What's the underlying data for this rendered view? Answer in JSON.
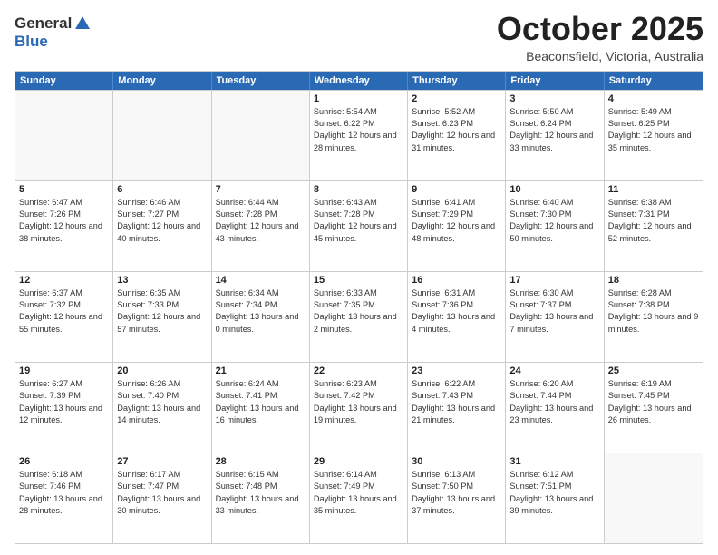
{
  "logo": {
    "line1": "General",
    "line2": "Blue"
  },
  "title": "October 2025",
  "location": "Beaconsfield, Victoria, Australia",
  "days_of_week": [
    "Sunday",
    "Monday",
    "Tuesday",
    "Wednesday",
    "Thursday",
    "Friday",
    "Saturday"
  ],
  "weeks": [
    [
      {
        "day": "",
        "empty": true
      },
      {
        "day": "",
        "empty": true
      },
      {
        "day": "",
        "empty": true
      },
      {
        "day": "1",
        "sunrise": "5:54 AM",
        "sunset": "6:22 PM",
        "daylight": "12 hours and 28 minutes."
      },
      {
        "day": "2",
        "sunrise": "5:52 AM",
        "sunset": "6:23 PM",
        "daylight": "12 hours and 31 minutes."
      },
      {
        "day": "3",
        "sunrise": "5:50 AM",
        "sunset": "6:24 PM",
        "daylight": "12 hours and 33 minutes."
      },
      {
        "day": "4",
        "sunrise": "5:49 AM",
        "sunset": "6:25 PM",
        "daylight": "12 hours and 35 minutes."
      }
    ],
    [
      {
        "day": "5",
        "sunrise": "6:47 AM",
        "sunset": "7:26 PM",
        "daylight": "12 hours and 38 minutes."
      },
      {
        "day": "6",
        "sunrise": "6:46 AM",
        "sunset": "7:27 PM",
        "daylight": "12 hours and 40 minutes."
      },
      {
        "day": "7",
        "sunrise": "6:44 AM",
        "sunset": "7:28 PM",
        "daylight": "12 hours and 43 minutes."
      },
      {
        "day": "8",
        "sunrise": "6:43 AM",
        "sunset": "7:28 PM",
        "daylight": "12 hours and 45 minutes."
      },
      {
        "day": "9",
        "sunrise": "6:41 AM",
        "sunset": "7:29 PM",
        "daylight": "12 hours and 48 minutes."
      },
      {
        "day": "10",
        "sunrise": "6:40 AM",
        "sunset": "7:30 PM",
        "daylight": "12 hours and 50 minutes."
      },
      {
        "day": "11",
        "sunrise": "6:38 AM",
        "sunset": "7:31 PM",
        "daylight": "12 hours and 52 minutes."
      }
    ],
    [
      {
        "day": "12",
        "sunrise": "6:37 AM",
        "sunset": "7:32 PM",
        "daylight": "12 hours and 55 minutes."
      },
      {
        "day": "13",
        "sunrise": "6:35 AM",
        "sunset": "7:33 PM",
        "daylight": "12 hours and 57 minutes."
      },
      {
        "day": "14",
        "sunrise": "6:34 AM",
        "sunset": "7:34 PM",
        "daylight": "13 hours and 0 minutes."
      },
      {
        "day": "15",
        "sunrise": "6:33 AM",
        "sunset": "7:35 PM",
        "daylight": "13 hours and 2 minutes."
      },
      {
        "day": "16",
        "sunrise": "6:31 AM",
        "sunset": "7:36 PM",
        "daylight": "13 hours and 4 minutes."
      },
      {
        "day": "17",
        "sunrise": "6:30 AM",
        "sunset": "7:37 PM",
        "daylight": "13 hours and 7 minutes."
      },
      {
        "day": "18",
        "sunrise": "6:28 AM",
        "sunset": "7:38 PM",
        "daylight": "13 hours and 9 minutes."
      }
    ],
    [
      {
        "day": "19",
        "sunrise": "6:27 AM",
        "sunset": "7:39 PM",
        "daylight": "13 hours and 12 minutes."
      },
      {
        "day": "20",
        "sunrise": "6:26 AM",
        "sunset": "7:40 PM",
        "daylight": "13 hours and 14 minutes."
      },
      {
        "day": "21",
        "sunrise": "6:24 AM",
        "sunset": "7:41 PM",
        "daylight": "13 hours and 16 minutes."
      },
      {
        "day": "22",
        "sunrise": "6:23 AM",
        "sunset": "7:42 PM",
        "daylight": "13 hours and 19 minutes."
      },
      {
        "day": "23",
        "sunrise": "6:22 AM",
        "sunset": "7:43 PM",
        "daylight": "13 hours and 21 minutes."
      },
      {
        "day": "24",
        "sunrise": "6:20 AM",
        "sunset": "7:44 PM",
        "daylight": "13 hours and 23 minutes."
      },
      {
        "day": "25",
        "sunrise": "6:19 AM",
        "sunset": "7:45 PM",
        "daylight": "13 hours and 26 minutes."
      }
    ],
    [
      {
        "day": "26",
        "sunrise": "6:18 AM",
        "sunset": "7:46 PM",
        "daylight": "13 hours and 28 minutes."
      },
      {
        "day": "27",
        "sunrise": "6:17 AM",
        "sunset": "7:47 PM",
        "daylight": "13 hours and 30 minutes."
      },
      {
        "day": "28",
        "sunrise": "6:15 AM",
        "sunset": "7:48 PM",
        "daylight": "13 hours and 33 minutes."
      },
      {
        "day": "29",
        "sunrise": "6:14 AM",
        "sunset": "7:49 PM",
        "daylight": "13 hours and 35 minutes."
      },
      {
        "day": "30",
        "sunrise": "6:13 AM",
        "sunset": "7:50 PM",
        "daylight": "13 hours and 37 minutes."
      },
      {
        "day": "31",
        "sunrise": "6:12 AM",
        "sunset": "7:51 PM",
        "daylight": "13 hours and 39 minutes."
      },
      {
        "day": "",
        "empty": true
      }
    ]
  ],
  "labels": {
    "sunrise": "Sunrise:",
    "sunset": "Sunset:",
    "daylight": "Daylight:"
  }
}
